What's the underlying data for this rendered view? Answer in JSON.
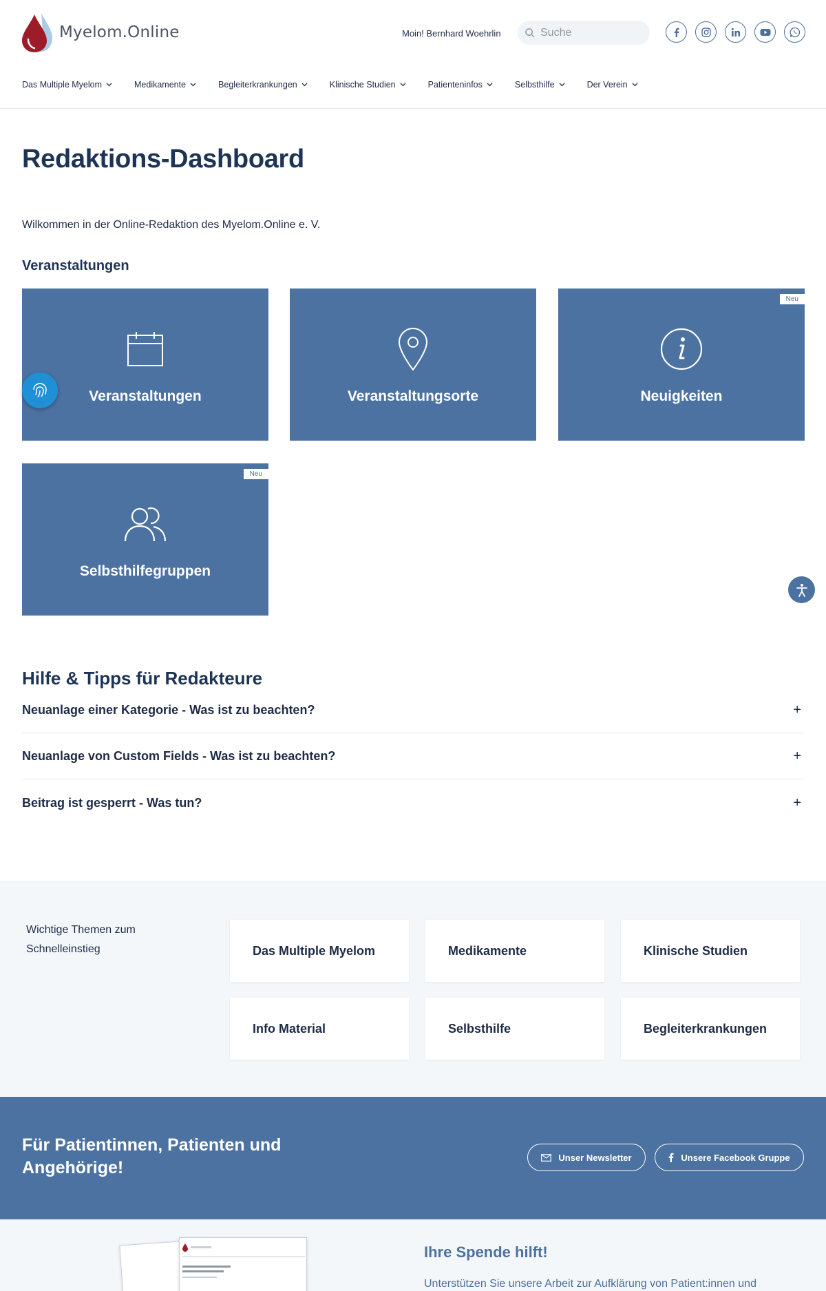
{
  "header": {
    "logo_text": "Myelom.Online",
    "greeting": "Moin! Bernhard Woehrlin",
    "search_placeholder": "Suche",
    "socials": [
      "facebook-icon",
      "instagram-icon",
      "linkedin-icon",
      "youtube-icon",
      "whatsapp-icon"
    ]
  },
  "nav": {
    "items": [
      {
        "label": "Das Multiple Myelom"
      },
      {
        "label": "Medikamente"
      },
      {
        "label": "Begleiterkrankungen"
      },
      {
        "label": "Klinische Studien"
      },
      {
        "label": "Patienteninfos"
      },
      {
        "label": "Selbsthilfe"
      },
      {
        "label": "Der Verein"
      }
    ]
  },
  "page": {
    "title": "Redaktions-Dashboard",
    "welcome": "Wilkommen in der Online-Redaktion des Myelom.Online e. V.",
    "section_title": "Veranstaltungen"
  },
  "tiles": [
    {
      "label": "Veranstaltungen",
      "icon": "calendar-icon",
      "badge": ""
    },
    {
      "label": "Veranstaltungsorte",
      "icon": "location-pin-icon",
      "badge": ""
    },
    {
      "label": "Neuigkeiten",
      "icon": "info-icon",
      "badge": "Neu"
    },
    {
      "label": "Selbsthilfegruppen",
      "icon": "users-icon",
      "badge": "Neu"
    }
  ],
  "help": {
    "title": "Hilfe & Tipps für Redakteure",
    "items": [
      {
        "question": "Neuanlage einer Kategorie - Was ist zu beachten?",
        "toggle": "+"
      },
      {
        "question": "Neuanlage von Custom Fields - Was ist zu beachten?",
        "toggle": "+"
      },
      {
        "question": "Beitrag ist gesperrt - Was tun?",
        "toggle": "+"
      }
    ]
  },
  "quick": {
    "intro": "Wichtige Themen zum Schnelleinstieg",
    "cards": [
      {
        "label": "Das Multiple Myelom"
      },
      {
        "label": "Medikamente"
      },
      {
        "label": "Klinische Studien"
      },
      {
        "label": "Info Material"
      },
      {
        "label": "Selbsthilfe"
      },
      {
        "label": "Begleiterkrankungen"
      }
    ]
  },
  "band": {
    "title": "Für Patientinnen, Patienten und Angehörige!",
    "newsletter_label": "Unser Newsletter",
    "facebook_label": "Unsere Facebook Gruppe"
  },
  "donate": {
    "title": "Ihre Spende hilft!",
    "text": "Unterstützen Sie unsere Arbeit zur Aufklärung von Patient:innen und"
  },
  "colors": {
    "primary": "#4c72a1",
    "heading": "#1d3456",
    "text": "#1d2b45",
    "light_bg": "#f4f7fa",
    "fab_blue": "#1f8fd6",
    "logo_red": "#9e1b2a",
    "logo_blue": "#a9cbe6"
  }
}
